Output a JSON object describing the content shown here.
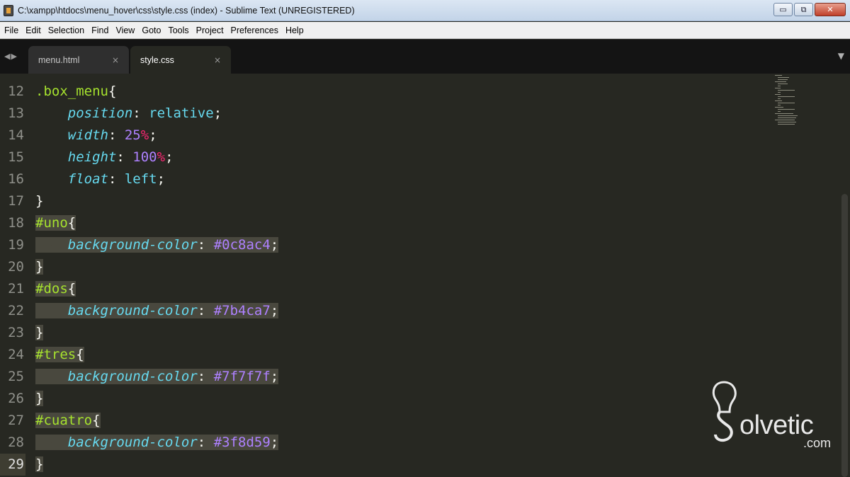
{
  "window": {
    "title": "C:\\xampp\\htdocs\\menu_hover\\css\\style.css (index) - Sublime Text (UNREGISTERED)",
    "minimize_glyph": "▭",
    "maximize_glyph": "⧉",
    "close_glyph": "✕"
  },
  "menubar": [
    "File",
    "Edit",
    "Selection",
    "Find",
    "View",
    "Goto",
    "Tools",
    "Project",
    "Preferences",
    "Help"
  ],
  "tabs": [
    {
      "label": "menu.html",
      "close": "×",
      "active": false
    },
    {
      "label": "style.css",
      "close": "×",
      "active": true
    }
  ],
  "tabbar": {
    "nav_arrows": "◀▶",
    "dropdown": "▼"
  },
  "colors": {
    "background": "#272822",
    "selector": "#a6e22e",
    "property": "#66d9ef",
    "number": "#ae81ff",
    "unit": "#f92672",
    "selection": "#49483e"
  },
  "editor": {
    "current_line": 29,
    "lines": [
      {
        "no": "12",
        "selected": false,
        "tokens": [
          {
            "t": ".box_menu",
            "c": "c-sel"
          },
          {
            "t": "{",
            "c": "c-punc"
          }
        ]
      },
      {
        "no": "13",
        "selected": false,
        "tokens": [
          {
            "t": "    ",
            "c": ""
          },
          {
            "t": "position",
            "c": "c-prop"
          },
          {
            "t": ": ",
            "c": "c-punc"
          },
          {
            "t": "relative",
            "c": "c-val"
          },
          {
            "t": ";",
            "c": "c-punc"
          }
        ]
      },
      {
        "no": "14",
        "selected": false,
        "tokens": [
          {
            "t": "    ",
            "c": ""
          },
          {
            "t": "width",
            "c": "c-prop"
          },
          {
            "t": ": ",
            "c": "c-punc"
          },
          {
            "t": "25",
            "c": "c-num"
          },
          {
            "t": "%",
            "c": "c-unit"
          },
          {
            "t": ";",
            "c": "c-punc"
          }
        ]
      },
      {
        "no": "15",
        "selected": false,
        "tokens": [
          {
            "t": "    ",
            "c": ""
          },
          {
            "t": "height",
            "c": "c-prop"
          },
          {
            "t": ": ",
            "c": "c-punc"
          },
          {
            "t": "100",
            "c": "c-num"
          },
          {
            "t": "%",
            "c": "c-unit"
          },
          {
            "t": ";",
            "c": "c-punc"
          }
        ]
      },
      {
        "no": "16",
        "selected": false,
        "tokens": [
          {
            "t": "    ",
            "c": ""
          },
          {
            "t": "float",
            "c": "c-prop"
          },
          {
            "t": ": ",
            "c": "c-punc"
          },
          {
            "t": "left",
            "c": "c-val"
          },
          {
            "t": ";",
            "c": "c-punc"
          }
        ]
      },
      {
        "no": "17",
        "selected": false,
        "tokens": [
          {
            "t": "}",
            "c": "c-punc"
          }
        ]
      },
      {
        "no": "18",
        "selected": true,
        "tokens": [
          {
            "t": "#uno",
            "c": "c-sel"
          },
          {
            "t": "{",
            "c": "c-punc"
          }
        ]
      },
      {
        "no": "19",
        "selected": true,
        "tokens": [
          {
            "t": "————",
            "c": "guide"
          },
          {
            "t": "background-color",
            "c": "c-prop"
          },
          {
            "t": ": ",
            "c": "c-punc"
          },
          {
            "t": "#0c8ac4",
            "c": "c-num"
          },
          {
            "t": ";",
            "c": "c-punc"
          }
        ]
      },
      {
        "no": "20",
        "selected": true,
        "tokens": [
          {
            "t": "}",
            "c": "c-punc"
          }
        ]
      },
      {
        "no": "21",
        "selected": true,
        "tokens": [
          {
            "t": "#dos",
            "c": "c-sel"
          },
          {
            "t": "{",
            "c": "c-punc"
          }
        ]
      },
      {
        "no": "22",
        "selected": true,
        "tokens": [
          {
            "t": "————",
            "c": "guide"
          },
          {
            "t": "background-color",
            "c": "c-prop"
          },
          {
            "t": ": ",
            "c": "c-punc"
          },
          {
            "t": "#7b4ca7",
            "c": "c-num"
          },
          {
            "t": ";",
            "c": "c-punc"
          }
        ]
      },
      {
        "no": "23",
        "selected": true,
        "tokens": [
          {
            "t": "}",
            "c": "c-punc"
          }
        ]
      },
      {
        "no": "24",
        "selected": true,
        "tokens": [
          {
            "t": "#tres",
            "c": "c-sel"
          },
          {
            "t": "{",
            "c": "c-punc"
          }
        ]
      },
      {
        "no": "25",
        "selected": true,
        "tokens": [
          {
            "t": "————",
            "c": "guide"
          },
          {
            "t": "background-color",
            "c": "c-prop"
          },
          {
            "t": ": ",
            "c": "c-punc"
          },
          {
            "t": "#7f7f7f",
            "c": "c-num"
          },
          {
            "t": ";",
            "c": "c-punc"
          }
        ]
      },
      {
        "no": "26",
        "selected": true,
        "tokens": [
          {
            "t": "}",
            "c": "c-punc"
          }
        ]
      },
      {
        "no": "27",
        "selected": true,
        "tokens": [
          {
            "t": "#cuatro",
            "c": "c-sel"
          },
          {
            "t": "{",
            "c": "c-punc"
          }
        ]
      },
      {
        "no": "28",
        "selected": true,
        "tokens": [
          {
            "t": "————",
            "c": "guide"
          },
          {
            "t": "background-color",
            "c": "c-prop"
          },
          {
            "t": ": ",
            "c": "c-punc"
          },
          {
            "t": "#3f8d59",
            "c": "c-num"
          },
          {
            "t": ";",
            "c": "c-punc"
          }
        ]
      },
      {
        "no": "29",
        "selected": true,
        "tokens": [
          {
            "t": "}",
            "c": "c-punc"
          }
        ]
      }
    ]
  },
  "watermark": {
    "name": "Solvetic",
    "text": "olvetic",
    "suffix": ".com"
  }
}
